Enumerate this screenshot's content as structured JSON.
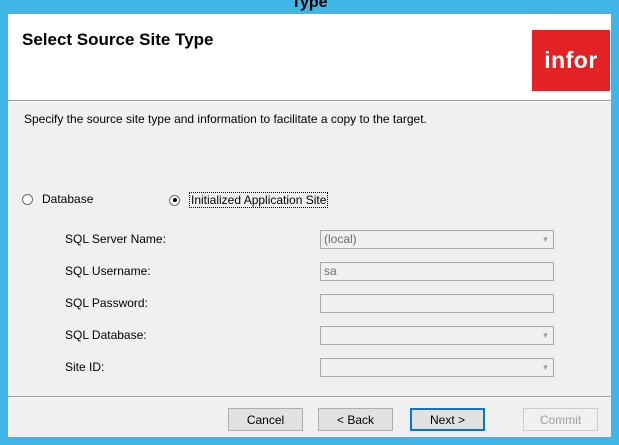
{
  "window": {
    "title_fragment": "Type"
  },
  "header": {
    "title": "Select Source Site Type",
    "logo_text": "infor"
  },
  "main": {
    "description": "Specify the source site type and information to facilitate a copy to the target.",
    "radio_options": [
      {
        "label": "Database",
        "selected": false
      },
      {
        "label": "Initialized Application Site",
        "selected": true
      }
    ],
    "fields": [
      {
        "label": "SQL Server Name:",
        "value": "(local)",
        "type": "combo"
      },
      {
        "label": "SQL Username:",
        "value": "sa",
        "type": "text"
      },
      {
        "label": "SQL Password:",
        "value": "",
        "type": "text"
      },
      {
        "label": "SQL Database:",
        "value": "",
        "type": "combo"
      },
      {
        "label": "Site ID:",
        "value": "",
        "type": "combo"
      }
    ]
  },
  "footer": {
    "buttons": [
      {
        "label": "Cancel",
        "enabled": true
      },
      {
        "label": "< Back",
        "enabled": true
      },
      {
        "label": "Next >",
        "enabled": true,
        "default": true
      },
      {
        "label": "Commit",
        "enabled": false
      }
    ]
  },
  "colors": {
    "frame": "#3fb6e6",
    "brand": "#e32226",
    "panel": "#f0f0f0"
  },
  "icons": [
    "chevron-down-icon"
  ]
}
